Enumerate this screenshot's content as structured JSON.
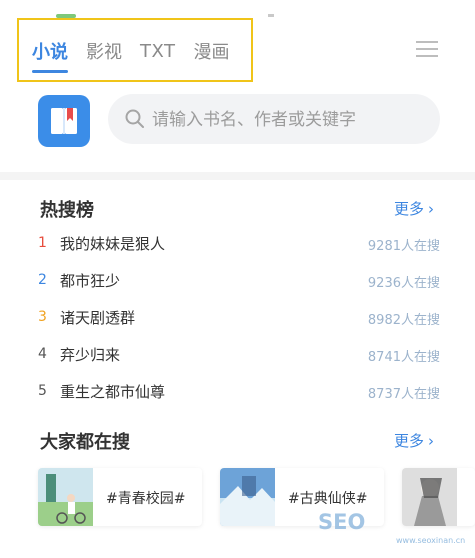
{
  "tabs": [
    {
      "label": "小说",
      "active": true
    },
    {
      "label": "影视",
      "active": false
    },
    {
      "label": "TXT",
      "active": false
    },
    {
      "label": "漫画",
      "active": false
    }
  ],
  "search": {
    "placeholder": "请输入书名、作者或关键字"
  },
  "hot": {
    "title": "热搜榜",
    "more": "更多",
    "items": [
      {
        "rank": "1",
        "title": "我的妹妹是狠人",
        "count": "9281人在搜",
        "rank_color": "#e74c3c"
      },
      {
        "rank": "2",
        "title": "都市狂少",
        "count": "9236人在搜",
        "rank_color": "#3d86e0"
      },
      {
        "rank": "3",
        "title": "诸天剧透群",
        "count": "8982人在搜",
        "rank_color": "#f0a322"
      },
      {
        "rank": "4",
        "title": "弃少归来",
        "count": "8741人在搜",
        "rank_color": "#555555"
      },
      {
        "rank": "5",
        "title": "重生之都市仙尊",
        "count": "8737人在搜",
        "rank_color": "#555555"
      }
    ]
  },
  "popular": {
    "title": "大家都在搜",
    "more": "更多",
    "cards": [
      {
        "label": "#青春校园#"
      },
      {
        "label": "#古典仙侠#"
      },
      {
        "label": ""
      }
    ]
  },
  "watermark": {
    "text": "SEO",
    "sub": "www.seoxinan.cn"
  },
  "colors": {
    "accent": "#3d86e0",
    "highlight_box": "#f0c419"
  }
}
